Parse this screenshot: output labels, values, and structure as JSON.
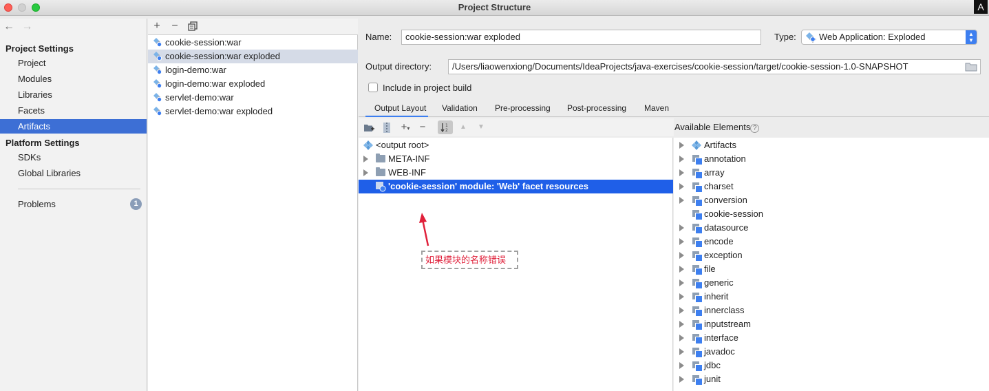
{
  "window": {
    "title": "Project Structure",
    "input_badge": "A"
  },
  "sidebar": {
    "back_icon": "←",
    "forward_icon": "→",
    "project_settings_heading": "Project Settings",
    "project_items": [
      "Project",
      "Modules",
      "Libraries",
      "Facets",
      "Artifacts"
    ],
    "selected_item": "Artifacts",
    "platform_settings_heading": "Platform Settings",
    "platform_items": [
      "SDKs",
      "Global Libraries"
    ],
    "problems_label": "Problems",
    "problems_count": "1"
  },
  "artifact_list": {
    "toolbar": {
      "add": "+",
      "remove": "−",
      "copy_icon": "copy-icon"
    },
    "items": [
      "cookie-session:war",
      "cookie-session:war exploded",
      "login-demo:war",
      "login-demo:war exploded",
      "servlet-demo:war",
      "servlet-demo:war exploded"
    ],
    "selected_index": 1
  },
  "form": {
    "name_label": "Name:",
    "name_value": "cookie-session:war exploded",
    "type_label": "Type:",
    "type_value": "Web Application: Exploded",
    "output_dir_label": "Output directory:",
    "output_dir_value": "/Users/liaowenxiong/Documents/IdeaProjects/java-exercises/cookie-session/target/cookie-session-1.0-SNAPSHOT",
    "include_in_build_label": "Include in project build",
    "include_in_build_checked": false
  },
  "tabs": [
    "Output Layout",
    "Validation",
    "Pre-processing",
    "Post-processing",
    "Maven"
  ],
  "active_tab": "Output Layout",
  "output_tree": {
    "rows": [
      {
        "label": "<output root>",
        "kind": "root"
      },
      {
        "label": "META-INF",
        "kind": "folder"
      },
      {
        "label": "WEB-INF",
        "kind": "folder"
      },
      {
        "label": "'cookie-session' module: 'Web' facet resources",
        "kind": "facet",
        "selected": true
      }
    ]
  },
  "annotation": {
    "text": "如果模块的名称错误",
    "color": "#e0203a"
  },
  "available": {
    "heading": "Available Elements",
    "help": "?",
    "items": [
      {
        "label": "Artifacts",
        "expandable": true,
        "icon": "artifact-icon"
      },
      {
        "label": "annotation",
        "expandable": true,
        "icon": "package-icon"
      },
      {
        "label": "array",
        "expandable": true,
        "icon": "package-icon"
      },
      {
        "label": "charset",
        "expandable": true,
        "icon": "package-icon"
      },
      {
        "label": "conversion",
        "expandable": true,
        "icon": "package-icon"
      },
      {
        "label": "cookie-session",
        "expandable": false,
        "icon": "package-icon"
      },
      {
        "label": "datasource",
        "expandable": true,
        "icon": "package-icon"
      },
      {
        "label": "encode",
        "expandable": true,
        "icon": "package-icon"
      },
      {
        "label": "exception",
        "expandable": true,
        "icon": "package-icon"
      },
      {
        "label": "file",
        "expandable": true,
        "icon": "package-icon"
      },
      {
        "label": "generic",
        "expandable": true,
        "icon": "package-icon"
      },
      {
        "label": "inherit",
        "expandable": true,
        "icon": "package-icon"
      },
      {
        "label": "innerclass",
        "expandable": true,
        "icon": "package-icon"
      },
      {
        "label": "inputstream",
        "expandable": true,
        "icon": "package-icon"
      },
      {
        "label": "interface",
        "expandable": true,
        "icon": "package-icon"
      },
      {
        "label": "javadoc",
        "expandable": true,
        "icon": "package-icon"
      },
      {
        "label": "jdbc",
        "expandable": true,
        "icon": "package-icon"
      },
      {
        "label": "junit",
        "expandable": true,
        "icon": "package-icon"
      }
    ]
  },
  "colors": {
    "selection": "#3d6fd5",
    "tree_selection": "#1f5fe8",
    "accent": "#3d7ff0"
  }
}
